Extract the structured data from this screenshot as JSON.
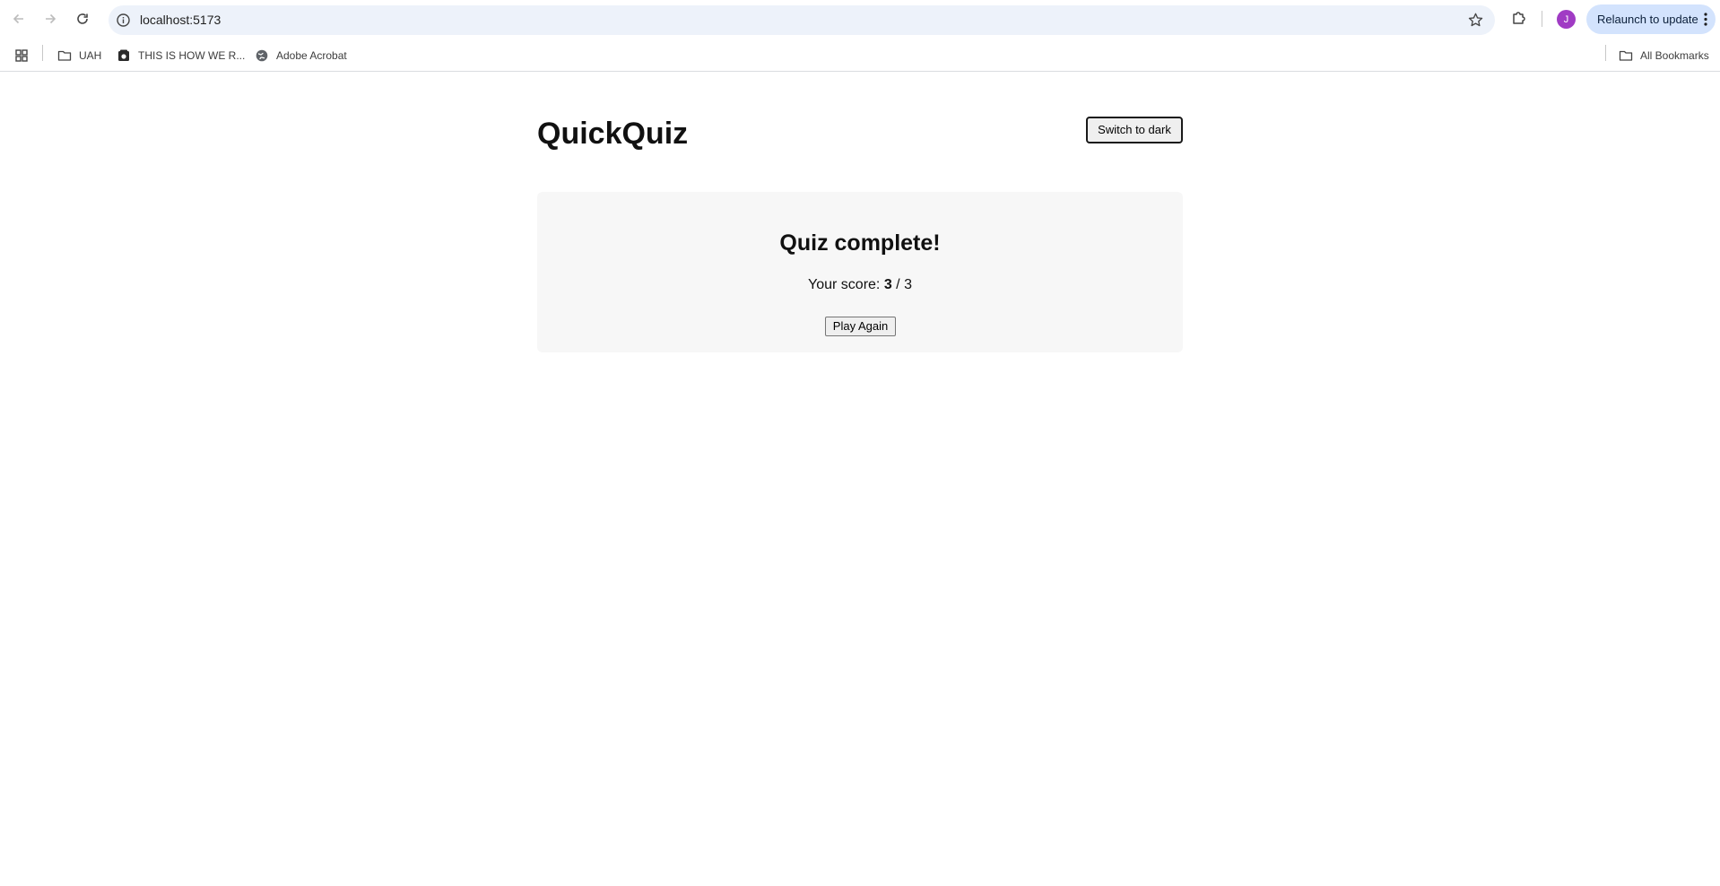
{
  "browser": {
    "url": "localhost:5173",
    "profile_initial": "J",
    "relaunch_label": "Relaunch to update",
    "icons": {
      "back": "back-arrow-icon",
      "forward": "forward-arrow-icon",
      "reload": "reload-icon",
      "site_info": "info-icon",
      "bookmark": "star-icon",
      "extensions": "puzzle-icon",
      "menu": "kebab-menu-icon"
    },
    "colors": {
      "omnibox_bg": "#edf2fa",
      "relaunch_bg": "#d3e3fd",
      "avatar_bg": "#a03bc4"
    }
  },
  "bookmarks": {
    "items": [
      {
        "label": "UAH",
        "icon": "folder-icon"
      },
      {
        "label": "THIS IS HOW WE R...",
        "icon": "site-favicon-icon"
      },
      {
        "label": "Adobe Acrobat",
        "icon": "globe-icon"
      }
    ],
    "all_bookmarks_label": "All Bookmarks"
  },
  "app": {
    "title": "QuickQuiz",
    "theme_toggle_label": "Switch to dark",
    "result": {
      "heading": "Quiz complete!",
      "score_prefix": "Your score:",
      "score": "3",
      "score_separator": "/",
      "total": "3",
      "play_again_label": "Play Again"
    },
    "colors": {
      "card_bg": "#f7f7f7",
      "text": "#111111"
    }
  }
}
